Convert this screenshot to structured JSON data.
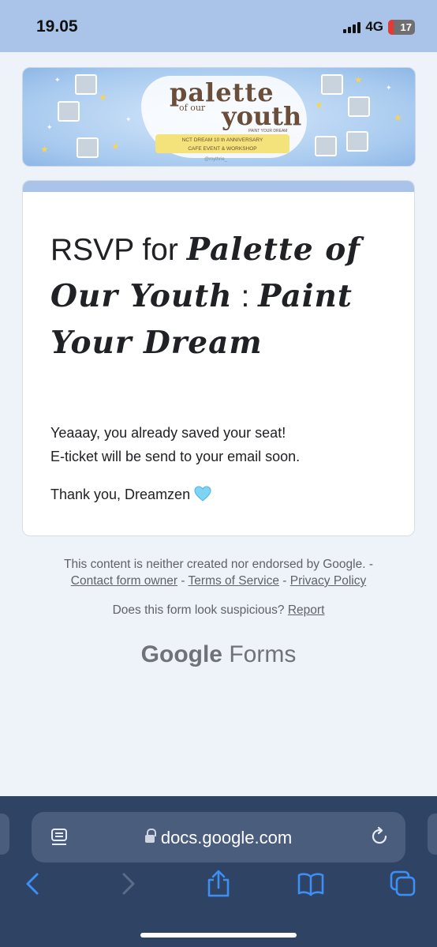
{
  "status_bar": {
    "time": "19.05",
    "network": "4G",
    "battery": "17"
  },
  "banner": {
    "title_line1": "palette",
    "title_of": "of our",
    "title_line2": "youth",
    "subtitle": "PAINT YOUR DREAM",
    "ribbon_line1": "NCT DREAM 10 th ANNIVERSARY",
    "ribbon_line2": "CAFE EVENT & WORKSHOP",
    "credit": "@mythrie_"
  },
  "form": {
    "title_prefix": "RSVP for ",
    "title_italic": "Palette of Our Youth",
    "title_colon": " : ",
    "title_italic2": "Paint Your Dream",
    "message": "Yeaaay, you already saved your seat!\nE-ticket will be send to your email soon.",
    "thanks": "Thank you, Dreamzen",
    "accent_color": "#a9c4e8"
  },
  "footer": {
    "disclaimer": "This content is neither created nor endorsed by Google. -",
    "contact_link": "Contact form owner",
    "terms_link": "Terms of Service",
    "privacy_link": "Privacy Policy",
    "separator": " - ",
    "suspicious_text": "Does this form look suspicious? ",
    "report_link": "Report",
    "brand_google": "Google",
    "brand_forms": " Forms"
  },
  "browser": {
    "url": "docs.google.com"
  }
}
